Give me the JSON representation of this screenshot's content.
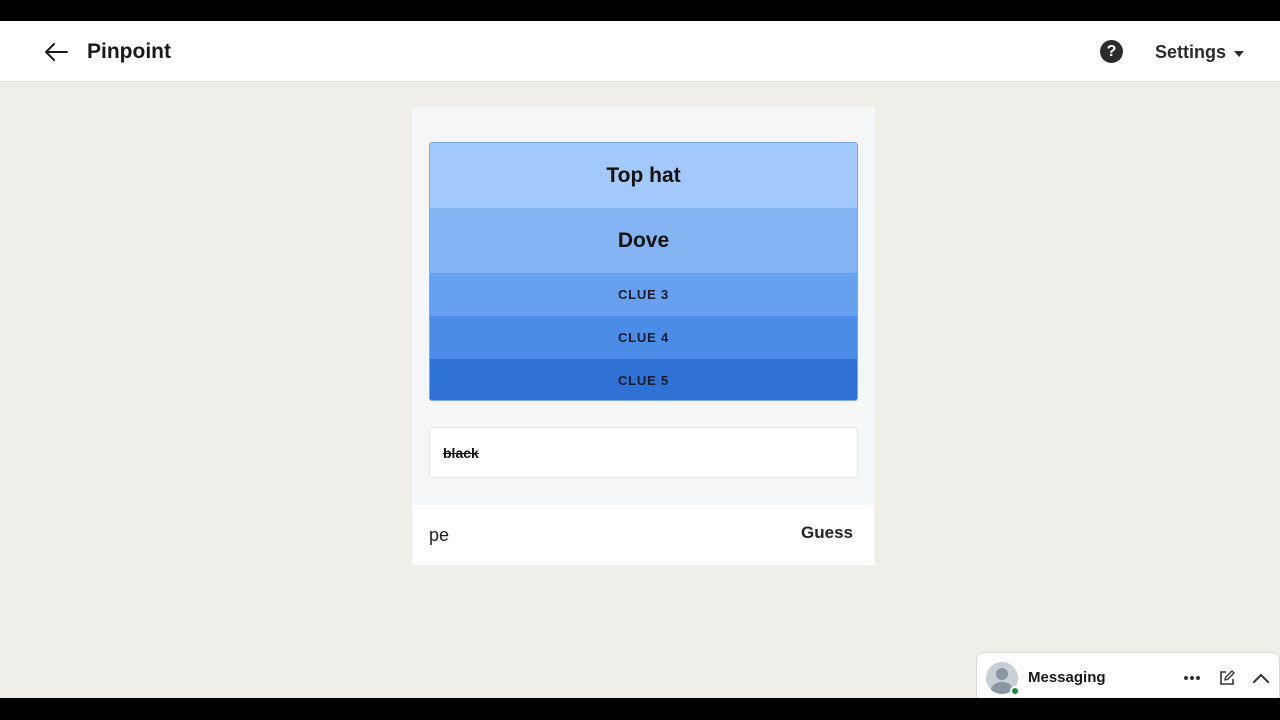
{
  "header": {
    "title": "Pinpoint",
    "settings_label": "Settings",
    "help_glyph": "?"
  },
  "clues": [
    {
      "label": "Top hat",
      "color": "#a3c9fc",
      "revealed": true
    },
    {
      "label": "Dove",
      "color": "#84b4f4",
      "revealed": true
    },
    {
      "label": "CLUE 3",
      "color": "#66a0ef",
      "revealed": false
    },
    {
      "label": "CLUE 4",
      "color": "#4a8ce6",
      "revealed": false
    },
    {
      "label": "CLUE 5",
      "color": "#2f71d4",
      "revealed": false
    }
  ],
  "guess_history": [
    "black"
  ],
  "guess_input": {
    "value": "pe"
  },
  "guess_button": "Guess",
  "messaging": {
    "title": "Messaging"
  }
}
